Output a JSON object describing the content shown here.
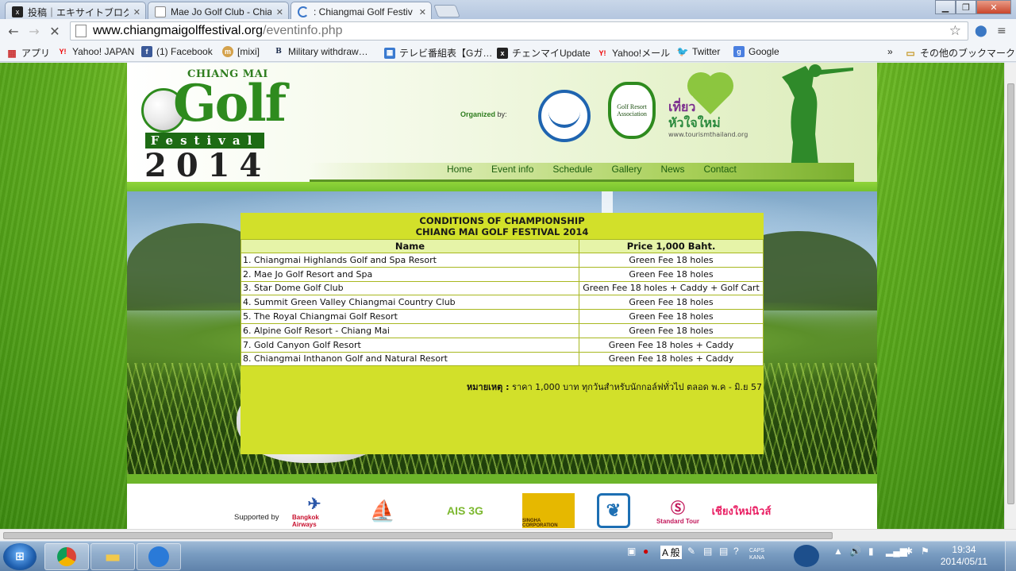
{
  "browser": {
    "tabs": [
      {
        "title": "投稿｜エキサイトブログ",
        "favicon": "x-icon",
        "active": false
      },
      {
        "title": "Mae Jo Golf Club - Chiang",
        "favicon": "page-icon",
        "active": false
      },
      {
        "title": ": Chiangmai Golf Festiv",
        "favicon": "loading-icon",
        "active": true
      }
    ],
    "url_domain": "www.chiangmaigolffestival.org",
    "url_path": "/eventinfo.php",
    "bookmarks": [
      {
        "label": "アプリ",
        "icon": "apps-grid-icon"
      },
      {
        "label": "Yahoo! JAPAN",
        "icon": "yahoo-icon"
      },
      {
        "label": "(1) Facebook",
        "icon": "facebook-icon"
      },
      {
        "label": "[mixi]",
        "icon": "mixi-icon"
      },
      {
        "label": "Military withdraw…",
        "icon": "b-icon"
      },
      {
        "label": "テレビ番組表【Gガ…",
        "icon": "tv-icon"
      },
      {
        "label": "チェンマイUpdate",
        "icon": "x-icon"
      },
      {
        "label": "Yahoo!メール",
        "icon": "yahoo-icon"
      },
      {
        "label": "Twitter",
        "icon": "twitter-icon"
      },
      {
        "label": "Google",
        "icon": "google-icon"
      }
    ],
    "other_bookmarks": "その他のブックマーク"
  },
  "site": {
    "logo": {
      "top": "CHIANG MAI",
      "main": "Golf",
      "festival": "Festival",
      "year": "2014"
    },
    "organized_label": "Organized",
    "organized_by": "by:",
    "ngra_text": "Golf Resort Association",
    "tiew_line1": "เที่ยว",
    "tiew_line2": "หัวใจใหม่",
    "tiew_line3": "www.tourismthailand.org",
    "menu": [
      "Home",
      "Event info",
      "Schedule",
      "Gallery",
      "News",
      "Contact"
    ],
    "table": {
      "title_line1": "CONDITIONS OF CHAMPIONSHIP",
      "title_line2": "CHIANG MAI GOLF FESTIVAL 2014",
      "headers": {
        "name": "Name",
        "price": "Price 1,000 Baht."
      },
      "rows": [
        {
          "name": "1. Chiangmai Highlands Golf and Spa Resort",
          "price": "Green Fee 18 holes"
        },
        {
          "name": "2. Mae Jo Golf Resort and Spa",
          "price": "Green Fee 18 holes"
        },
        {
          "name": "3. Star Dome Golf Club",
          "price": "Green Fee 18 holes + Caddy + Golf Cart"
        },
        {
          "name": "4. Summit Green Valley Chiangmai Country Club",
          "price": "Green Fee 18 holes"
        },
        {
          "name": "5. The Royal Chiangmai Golf Resort",
          "price": "Green Fee 18 holes"
        },
        {
          "name": "6. Alpine Golf Resort - Chiang Mai",
          "price": "Green Fee 18 holes"
        },
        {
          "name": "7. Gold Canyon Golf Resort",
          "price": "Green Fee 18 holes + Caddy"
        },
        {
          "name": "8. Chiangmai Inthanon Golf and Natural Resort",
          "price": "Green Fee 18 holes + Caddy"
        }
      ],
      "note_label": "หมายเหตุ :",
      "note_text": "ราคา 1,000 บาท ทุกวันสำหรับนักกอล์ฟทั่วไป ตลอด พ.ค - มิ.ย 57"
    },
    "supported_by": "Supported by",
    "sponsors": [
      {
        "name": "Bangkok Airways",
        "color": "#c8102e"
      },
      {
        "name": "ship-logo",
        "color": "#9b6b3a"
      },
      {
        "name": "AIS 3G",
        "color": "#7cb82f"
      },
      {
        "name": "SINGHA CORPORATION",
        "color": "#d9a300"
      },
      {
        "name": "bangchak-logo",
        "color": "#1d6fb3"
      },
      {
        "name": "Standard Tour",
        "color": "#c2185b"
      },
      {
        "name": "เชียงใหม่นิวส์",
        "color": "#e91e63"
      }
    ]
  },
  "taskbar": {
    "ime": "A 般",
    "caps": "CAPS",
    "kana": "KANA",
    "time": "19:34",
    "date": "2014/05/11"
  },
  "colors": {
    "table_bg": "#d2e02a",
    "header_green": "#2e8b1e",
    "menu_text": "#1d5e10"
  }
}
